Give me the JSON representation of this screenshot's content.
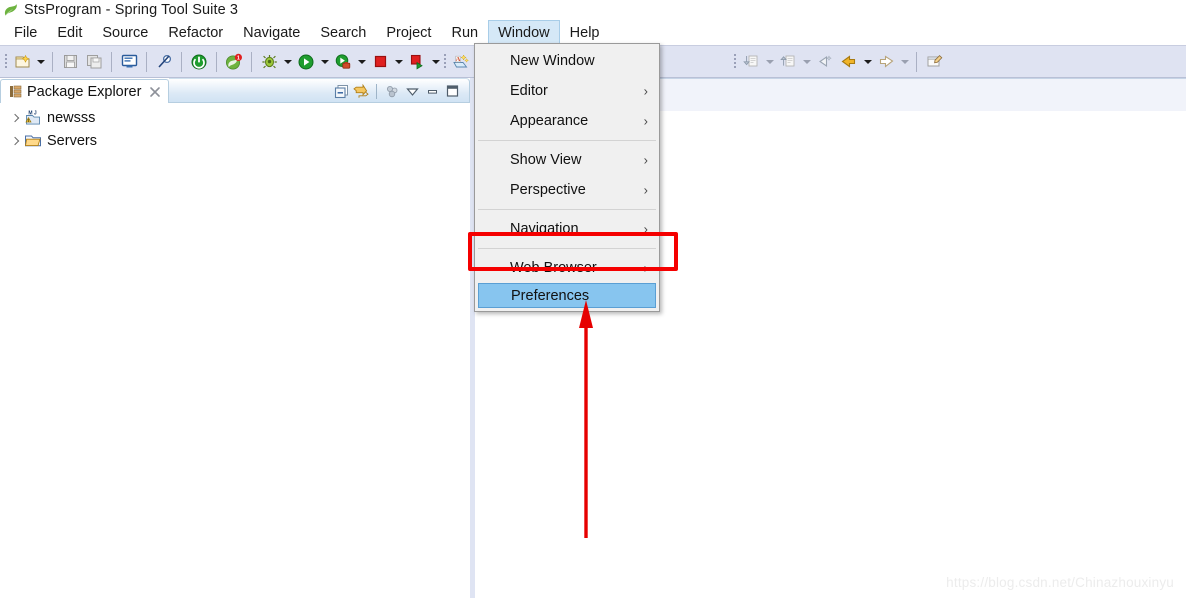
{
  "window": {
    "title": "StsProgram - Spring Tool Suite 3",
    "logo_icon": "spring-leaf-icon"
  },
  "menubar": {
    "items": [
      {
        "label": "File",
        "active": false
      },
      {
        "label": "Edit",
        "active": false
      },
      {
        "label": "Source",
        "active": false
      },
      {
        "label": "Refactor",
        "active": false
      },
      {
        "label": "Navigate",
        "active": false
      },
      {
        "label": "Search",
        "active": false
      },
      {
        "label": "Project",
        "active": false
      },
      {
        "label": "Run",
        "active": false
      },
      {
        "label": "Window",
        "active": true
      },
      {
        "label": "Help",
        "active": false
      }
    ]
  },
  "toolbar": {
    "buttons": [
      {
        "name": "new-icon"
      },
      {
        "name": "save-icon"
      },
      {
        "name": "save-all-icon"
      },
      {
        "name": "console-icon"
      },
      {
        "name": "toggle-breakpoint-icon"
      },
      {
        "name": "boot-dashboard-icon"
      },
      {
        "name": "spring-restart-icon"
      },
      {
        "name": "debug-icon"
      },
      {
        "name": "run-icon"
      },
      {
        "name": "run-external-tools-icon"
      },
      {
        "name": "terminate-icon"
      },
      {
        "name": "relaunch-icon"
      },
      {
        "name": "new-java-class-icon"
      },
      {
        "name": "new-java-package-icon"
      },
      {
        "name": "next-annotation-icon"
      },
      {
        "name": "previous-annotation-icon"
      },
      {
        "name": "last-edit-location-icon"
      },
      {
        "name": "back-icon"
      },
      {
        "name": "forward-icon"
      },
      {
        "name": "new-editor-icon"
      }
    ]
  },
  "package_explorer": {
    "tab_label": "Package Explorer",
    "tab_icon": "package-explorer-icon",
    "close_icon": "close-icon",
    "view_toolbar": [
      {
        "name": "collapse-all-icon"
      },
      {
        "name": "link-with-editor-icon"
      },
      {
        "name": "view-menu-filters-icon"
      },
      {
        "name": "view-menu-icon"
      },
      {
        "name": "minimize-icon"
      },
      {
        "name": "maximize-icon"
      }
    ],
    "tree": [
      {
        "label": "newsss",
        "icon": "maven-java-project-warning-icon",
        "expanded": false
      },
      {
        "label": "Servers",
        "icon": "folder-icon",
        "expanded": false
      }
    ]
  },
  "window_menu": {
    "groups": [
      {
        "items": [
          {
            "label": "New Window",
            "submenu": false,
            "selected": false
          },
          {
            "label": "Editor",
            "submenu": true,
            "selected": false
          },
          {
            "label": "Appearance",
            "submenu": true,
            "selected": false
          }
        ]
      },
      {
        "items": [
          {
            "label": "Show View",
            "submenu": true,
            "selected": false
          },
          {
            "label": "Perspective",
            "submenu": true,
            "selected": false
          }
        ]
      },
      {
        "items": [
          {
            "label": "Navigation",
            "submenu": true,
            "selected": false
          }
        ]
      },
      {
        "items": [
          {
            "label": "Web Browser",
            "submenu": true,
            "selected": false
          },
          {
            "label": "Preferences",
            "submenu": false,
            "selected": true
          }
        ]
      }
    ],
    "submenu_glyph": "›"
  },
  "annotations": {
    "highlight_color": "#f50000",
    "arrow_color": "#e60000",
    "highlight_target": "Preferences",
    "arrow_name": "red-up-arrow-annotation"
  },
  "watermark": {
    "text": "https://blog.csdn.net/Chinazhouxinyu"
  }
}
